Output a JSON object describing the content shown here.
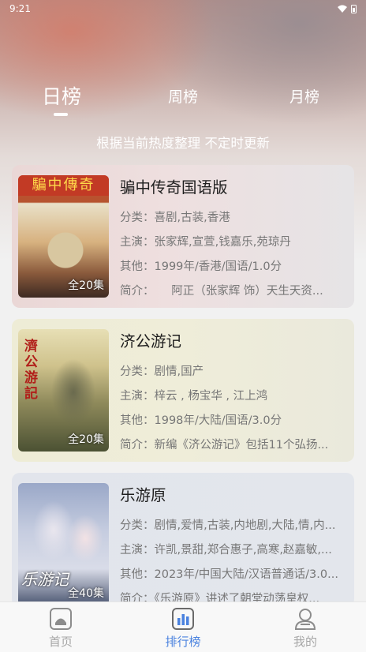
{
  "status_bar": {
    "time": "9:21"
  },
  "tabs": [
    {
      "label": "日榜",
      "active": true
    },
    {
      "label": "周榜",
      "active": false
    },
    {
      "label": "月榜",
      "active": false
    }
  ],
  "subtitle": "根据当前热度整理 不定时更新",
  "items": [
    {
      "poster_text": "騙中傳奇",
      "episodes": "全20集",
      "title": "骗中传奇国语版",
      "category": "分类：喜剧,古装,香港",
      "cast": "主演：张家辉,宣萱,钱嘉乐,苑琼丹",
      "other": "其他：1999年/香港/国语/1.0分",
      "intro": "简介：　　阿正（张家辉 饰）天生天资..."
    },
    {
      "poster_text": "濟公游記",
      "episodes": "全20集",
      "title": "济公游记",
      "category": "分类：剧情,国产",
      "cast": "主演：梓云 , 杨宝华 , 江上鸿",
      "other": "其他：1998年/大陆/国语/3.0分",
      "intro": "简介：新编《济公游记》包括11个弘扬..."
    },
    {
      "poster_text": "乐游记",
      "episodes": "全40集",
      "title": "乐游原",
      "category": "分类：剧情,爱情,古装,内地剧,大陆,情,内...",
      "cast": "主演：许凯,景甜,郑合惠子,高寒,赵嘉敏,...",
      "other": "其他：2023年/中国大陆/汉语普通话/3.0...",
      "intro": "简介：《乐游原》讲述了朝堂动荡皇权..."
    }
  ],
  "bottom_nav": [
    {
      "label": "首页",
      "icon": "home-icon",
      "active": false
    },
    {
      "label": "排行榜",
      "icon": "ranking-icon",
      "active": true
    },
    {
      "label": "我的",
      "icon": "profile-icon",
      "active": false
    }
  ],
  "colors": {
    "accent": "#4a82df",
    "inactive": "#a6a6a6"
  }
}
